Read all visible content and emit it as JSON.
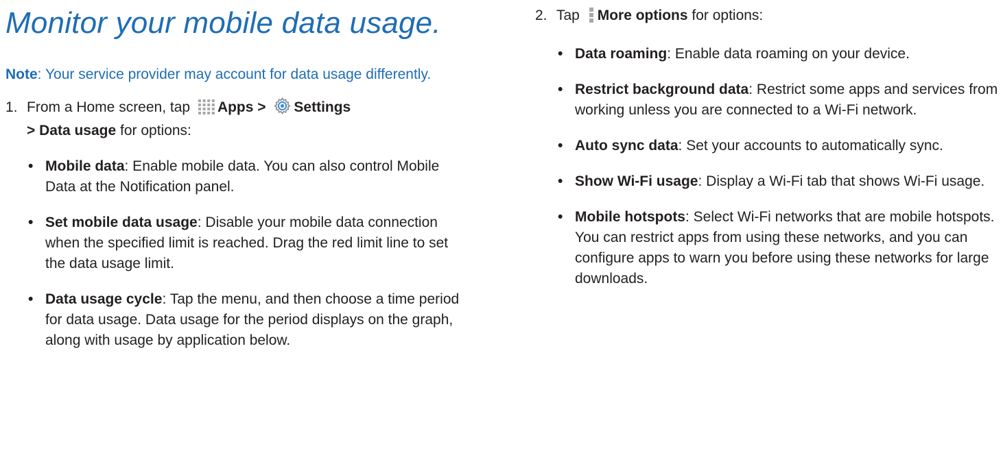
{
  "title": "Monitor your mobile data usage.",
  "note": {
    "label": "Note",
    "text": ": Your service provider may account for data usage differently."
  },
  "step1": {
    "number": "1.",
    "prefix": "From a Home screen, tap",
    "apps_label": "Apps",
    "sep1": ">",
    "settings_label": "Settings",
    "sep2": ">",
    "data_usage_label": "Data usage",
    "suffix": "for options:",
    "bullets": [
      {
        "term": "Mobile data",
        "text": ": Enable mobile data. You can also control Mobile Data at the Notification panel."
      },
      {
        "term": "Set mobile data usage",
        "text": ": Disable your mobile data connection when the specified limit is reached. Drag the red limit line to set the data usage limit."
      },
      {
        "term": "Data usage cycle",
        "text": ": Tap the menu, and then choose a time period for data usage. Data usage for the period displays on the graph, along with usage by application below."
      }
    ]
  },
  "step2": {
    "number": "2.",
    "prefix": "Tap",
    "more_label": "More options",
    "suffix": "for options:",
    "bullets": [
      {
        "term": "Data roaming",
        "text": ": Enable data roaming on your device."
      },
      {
        "term": "Restrict background data",
        "text": ": Restrict some apps and services from working unless you are connected to a Wi-Fi network."
      },
      {
        "term": "Auto sync data",
        "text": ": Set your accounts to automatically sync."
      },
      {
        "term": "Show Wi-Fi usage",
        "text": ": Display a Wi-Fi tab that shows Wi-Fi usage."
      },
      {
        "term": "Mobile hotspots",
        "text": ": Select Wi-Fi networks that are mobile hotspots. You can restrict apps from using these networks, and you can configure apps to warn you before using these networks for large downloads."
      }
    ]
  },
  "icons": {
    "apps": "apps-grid-icon",
    "settings": "settings-gear-icon",
    "more": "more-options-icon"
  },
  "colors": {
    "accent": "#1f6db4",
    "text": "#231f20"
  }
}
